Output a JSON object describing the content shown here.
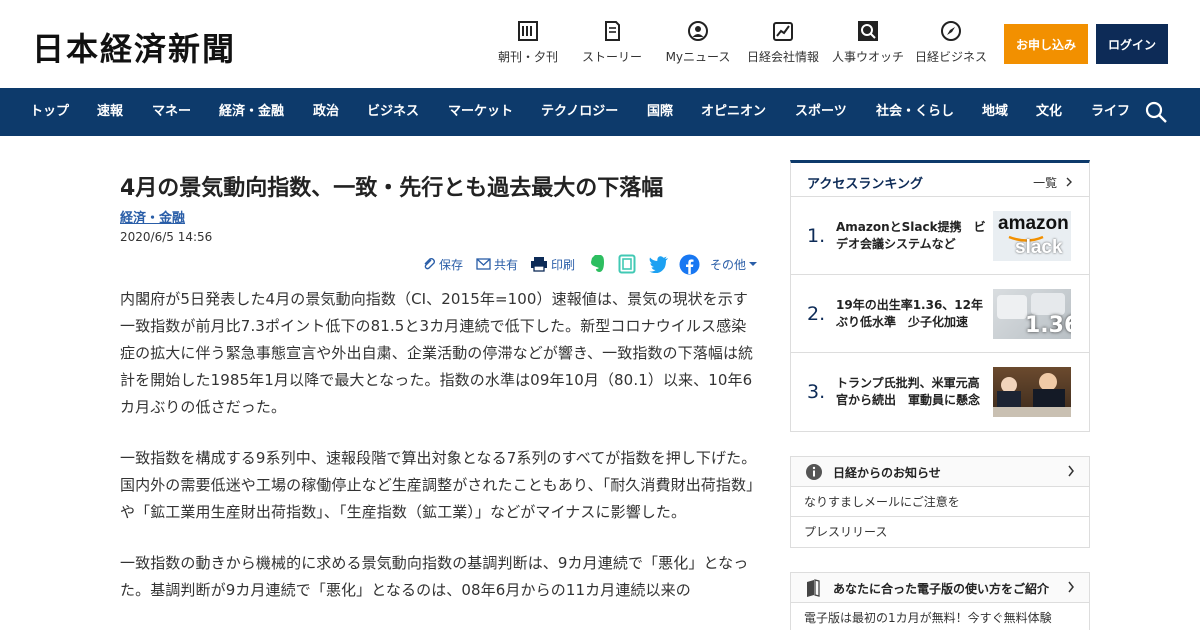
{
  "header": {
    "logo": "日本経済新聞",
    "nav": [
      {
        "icon": "newspaper-icon",
        "label": "朝刊・夕刊"
      },
      {
        "icon": "story-icon",
        "label": "ストーリー"
      },
      {
        "icon": "user-icon",
        "label": "Myニュース"
      },
      {
        "icon": "chart-icon",
        "label": "日経会社情報"
      },
      {
        "icon": "search-person-icon",
        "label": "人事ウオッチ"
      },
      {
        "icon": "compass-icon",
        "label": "日経ビジネス"
      }
    ],
    "apply_label": "お申し込み",
    "login_label": "ログイン",
    "accent_color": "#f29000",
    "brand_color": "#0d3a6b"
  },
  "navbar": {
    "items": [
      "トップ",
      "速報",
      "マネー",
      "経済・金融",
      "政治",
      "ビジネス",
      "マーケット",
      "テクノロジー",
      "国際",
      "オピニオン",
      "スポーツ",
      "社会・くらし",
      "地域",
      "文化",
      "ライフ"
    ]
  },
  "article": {
    "title": "4月の景気動向指数、一致・先行とも過去最大の下落幅",
    "category": "経済・金融",
    "date": "2020/6/5 14:56",
    "tools": {
      "save": "保存",
      "share": "共有",
      "print": "印刷",
      "more": "その他"
    },
    "paragraphs": [
      "内閣府が5日発表した4月の景気動向指数（CI、2015年=100）速報値は、景気の現状を示す一致指数が前月比7.3ポイント低下の81.5と3カ月連続で低下した。新型コロナウイルス感染症の拡大に伴う緊急事態宣言や外出自粛、企業活動の停滞などが響き、一致指数の下落幅は統計を開始した1985年1月以降で最大となった。指数の水準は09年10月（80.1）以来、10年6カ月ぶりの低さだった。",
      "一致指数を構成する9系列中、速報段階で算出対象となる7系列のすべてが指数を押し下げた。国内外の需要低迷や工場の稼働停止など生産調整がされたこともあり、「耐久消費財出荷指数」や「鉱工業用生産財出荷指数」、「生産指数（鉱工業）」などがマイナスに影響した。",
      "一致指数の動きから機械的に求める景気動向指数の基調判断は、9カ月連続で「悪化」となった。基調判断が9カ月連続で「悪化」となるのは、08年6月からの11カ月連続以来の"
    ]
  },
  "ranking": {
    "title": "アクセスランキング",
    "all_label": "一覧",
    "items": [
      {
        "num": "1.",
        "text": "AmazonとSlack提携　ビデオ会議システムなど",
        "thumb_a": "amazon",
        "thumb_b": "slack"
      },
      {
        "num": "2.",
        "text": "19年の出生率1.36、12年ぶり低水準　少子化加速",
        "thumb_a": "1.36"
      },
      {
        "num": "3.",
        "text": "トランプ氏批判、米軍元高官から続出　軍動員に懸念"
      }
    ]
  },
  "notice": {
    "title": "日経からのお知らせ",
    "rows": [
      "なりすましメールにご注意を",
      "プレスリリース"
    ]
  },
  "guide": {
    "title": "あなたに合った電子版の使い方をご紹介",
    "rows": [
      "電子版は最初の1カ月が無料！今すぐ無料体験"
    ]
  }
}
